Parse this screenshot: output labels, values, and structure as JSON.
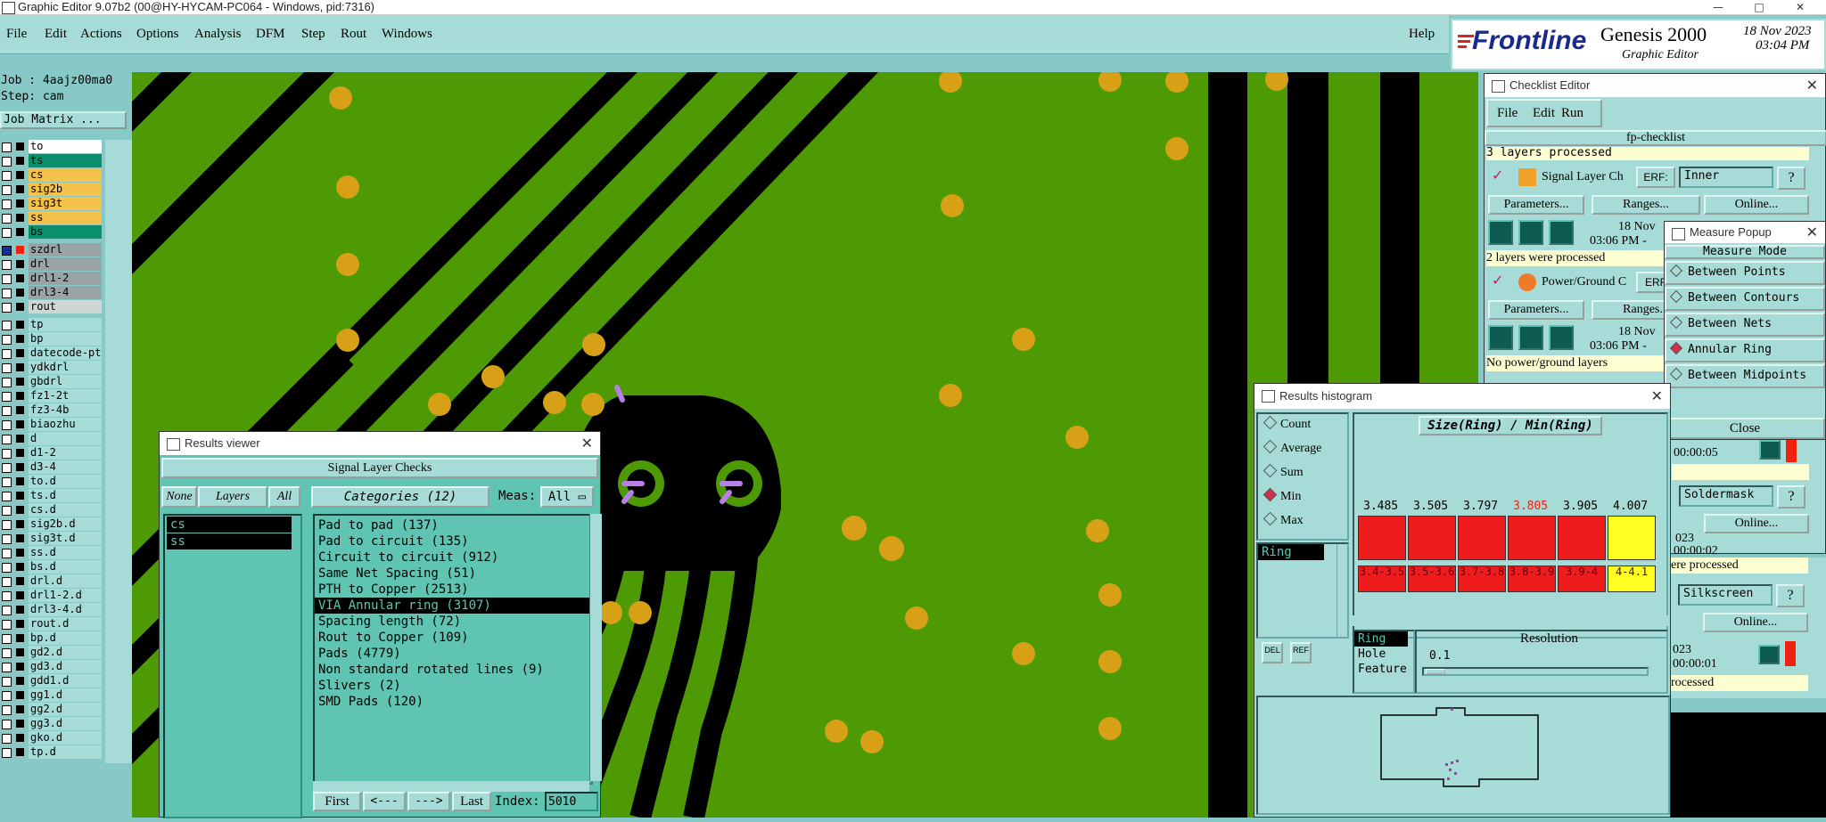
{
  "window": {
    "title": "Graphic Editor 9.07b2 (00@HY-HYCAM-PC064 - Windows, pid:7316)",
    "controls": [
      "—",
      "□",
      "✕"
    ]
  },
  "menu": {
    "items": [
      "File",
      "Edit",
      "Actions",
      "Options",
      "Analysis",
      "DFM",
      "Step",
      "Rout",
      "Windows"
    ],
    "help": "Help"
  },
  "brand": {
    "logo": "Frontline",
    "product": "Genesis 2000",
    "subtitle": "Graphic Editor",
    "date": "18 Nov 2023",
    "time": "03:04 PM"
  },
  "job": {
    "job": "Job : 4aajz00ma0",
    "step": "Step: cam",
    "matrix_button": "Job Matrix ..."
  },
  "layers": [
    {
      "name": "to",
      "bg": "#ffffff"
    },
    {
      "name": "ts",
      "bg": "#0b8f6a"
    },
    {
      "name": "cs",
      "bg": "#f4c14a"
    },
    {
      "name": "sig2b",
      "bg": "#f4c14a"
    },
    {
      "name": "sig3t",
      "bg": "#f4c14a"
    },
    {
      "name": "ss",
      "bg": "#f4c14a"
    },
    {
      "name": "bs",
      "bg": "#0b8f6a"
    },
    {
      "name": "szdrl",
      "bg": "#9aa3a6",
      "active": true
    },
    {
      "name": "drl",
      "bg": "#9aa3a6"
    },
    {
      "name": "drl1-2",
      "bg": "#9aa3a6"
    },
    {
      "name": "drl3-4",
      "bg": "#9aa3a6"
    },
    {
      "name": "rout",
      "bg": "#cfd6d4"
    },
    {
      "name": "tp",
      "bg": "#a7dbd8"
    },
    {
      "name": "bp",
      "bg": "#a7dbd8"
    },
    {
      "name": "datecode-pt",
      "bg": "#a7dbd8"
    },
    {
      "name": "ydkdrl",
      "bg": "#a7dbd8"
    },
    {
      "name": "gbdrl",
      "bg": "#a7dbd8"
    },
    {
      "name": "fz1-2t",
      "bg": "#a7dbd8"
    },
    {
      "name": "fz3-4b",
      "bg": "#a7dbd8"
    },
    {
      "name": "biaozhu",
      "bg": "#a7dbd8"
    },
    {
      "name": "d",
      "bg": "#a7dbd8"
    },
    {
      "name": "d1-2",
      "bg": "#a7dbd8"
    },
    {
      "name": "d3-4",
      "bg": "#a7dbd8"
    },
    {
      "name": "to.d",
      "bg": "#a7dbd8"
    },
    {
      "name": "ts.d",
      "bg": "#a7dbd8"
    },
    {
      "name": "cs.d",
      "bg": "#a7dbd8"
    },
    {
      "name": "sig2b.d",
      "bg": "#a7dbd8"
    },
    {
      "name": "sig3t.d",
      "bg": "#a7dbd8"
    },
    {
      "name": "ss.d",
      "bg": "#a7dbd8"
    },
    {
      "name": "bs.d",
      "bg": "#a7dbd8"
    },
    {
      "name": "drl.d",
      "bg": "#a7dbd8"
    },
    {
      "name": "drl1-2.d",
      "bg": "#a7dbd8"
    },
    {
      "name": "drl3-4.d",
      "bg": "#a7dbd8"
    },
    {
      "name": "rout.d",
      "bg": "#a7dbd8"
    },
    {
      "name": "bp.d",
      "bg": "#a7dbd8"
    },
    {
      "name": "gd2.d",
      "bg": "#a7dbd8"
    },
    {
      "name": "gd3.d",
      "bg": "#a7dbd8"
    },
    {
      "name": "gdd1.d",
      "bg": "#a7dbd8"
    },
    {
      "name": "gg1.d",
      "bg": "#a7dbd8"
    },
    {
      "name": "gg2.d",
      "bg": "#a7dbd8"
    },
    {
      "name": "gg3.d",
      "bg": "#a7dbd8"
    },
    {
      "name": "gko.d",
      "bg": "#a7dbd8"
    },
    {
      "name": "tp.d",
      "bg": "#a7dbd8"
    }
  ],
  "results_viewer": {
    "title": "Results viewer",
    "header": "Signal Layer Checks",
    "buttons": {
      "none": "None",
      "layers": "Layers",
      "all": "All",
      "categories": "Categories (12)",
      "meas_label": "Meas:",
      "meas_value": "All"
    },
    "layer_list": [
      "cs",
      "ss"
    ],
    "categories": [
      "Pad to pad (137)",
      "Pad to circuit (135)",
      "Circuit to circuit (912)",
      "Same Net Spacing (51)",
      "PTH to Copper (2513)",
      "VIA Annular ring (3107)",
      "Spacing length (72)",
      "Rout to Copper (109)",
      "Pads (4779)",
      "Non standard rotated lines (9)",
      "Slivers (2)",
      "SMD Pads (120)"
    ],
    "selected_category": 5,
    "nav": {
      "first": "First",
      "prev": "<---",
      "next": "--->",
      "last": "Last",
      "index_label": "Index:",
      "index_value": "5010"
    }
  },
  "checklist": {
    "title": "Checklist Editor",
    "menu": [
      "File",
      "Edit",
      "Run"
    ],
    "name": "fp-checklist",
    "status1": "3 layers processed",
    "item1": {
      "name": "Signal Layer Ch",
      "erf": "ERF:",
      "erf_value": "Inner",
      "q": "?"
    },
    "params": "Parameters...",
    "ranges": "Ranges...",
    "online": "Online...",
    "date": "18 Nov",
    "time1": "03:06 PM -",
    "status2": "2 layers were processed",
    "item2": {
      "name": "Power/Ground C",
      "erf": "ERF"
    },
    "time2": "03:06 PM -",
    "status3": "No power/ground layers",
    "right_rows": {
      "time_a": "00:00:05",
      "soldermask": "Soldermask",
      "online": "Online...",
      "year": "023",
      "time_b": "00:00:02",
      "processed": "ere processed",
      "silkscreen": "Silkscreen",
      "time_c": "00:00:01",
      "processed2": "rocessed"
    }
  },
  "measure": {
    "title": "Measure Popup",
    "header": "Measure Mode",
    "modes": [
      "Between Points",
      "Between Contours",
      "Between Nets",
      "Annular Ring",
      "Between Midpoints"
    ],
    "selected": 3,
    "close": "Close"
  },
  "histogram": {
    "title": "Results histogram",
    "options": [
      "Count",
      "Average",
      "Sum",
      "Min",
      "Max"
    ],
    "selected": 3,
    "list": [
      "Ring"
    ],
    "header": "Size(Ring) / Min(Ring)",
    "bars": [
      {
        "value": "3.485",
        "range": "3.4-3.5",
        "color": "#ee1c1c"
      },
      {
        "value": "3.505",
        "range": "3.5-3.6",
        "color": "#ee1c1c"
      },
      {
        "value": "3.797",
        "range": "3.7-3.8",
        "color": "#ee1c1c"
      },
      {
        "value": "3.805",
        "range": "3.8-3.9",
        "color": "#ee1c1c",
        "hl": true
      },
      {
        "value": "3.905",
        "range": "3.9-4",
        "color": "#ee1c1c"
      },
      {
        "value": "4.007",
        "range": "4-4.1",
        "color": "#ffff22"
      }
    ],
    "attrs": [
      "Ring",
      "Hole",
      "Feature"
    ],
    "resolution_label": "Resolution",
    "resolution_value": "0.1",
    "del": "DEL",
    "ref": "REF"
  }
}
